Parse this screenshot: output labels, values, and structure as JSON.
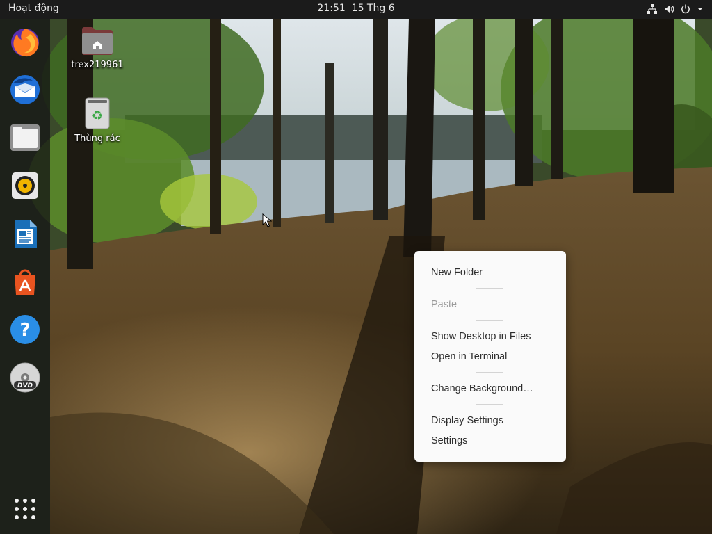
{
  "topbar": {
    "activities": "Hoạt động",
    "time": "21:51",
    "date": "15 Thg 6",
    "icons": [
      "network-icon",
      "volume-icon",
      "power-icon",
      "chevron-down-icon"
    ]
  },
  "dock": {
    "items": [
      {
        "name": "firefox-icon"
      },
      {
        "name": "thunderbird-icon"
      },
      {
        "name": "files-icon"
      },
      {
        "name": "rhythmbox-icon"
      },
      {
        "name": "libreoffice-writer-icon"
      },
      {
        "name": "app-center-icon"
      },
      {
        "name": "help-icon"
      },
      {
        "name": "dvd-icon"
      },
      {
        "name": "show-apps-icon"
      }
    ]
  },
  "desktop": {
    "home_label": "trex219961",
    "trash_label": "Thùng rác"
  },
  "context_menu": {
    "new_folder": "New Folder",
    "paste": "Paste",
    "show_desktop": "Show Desktop in Files",
    "open_terminal": "Open in Terminal",
    "change_background": "Change Background…",
    "display_settings": "Display Settings",
    "settings": "Settings"
  },
  "colors": {
    "topbar": "#1b1b1b",
    "menu_bg": "#fafafa",
    "ubuntu_orange": "#e95420"
  }
}
